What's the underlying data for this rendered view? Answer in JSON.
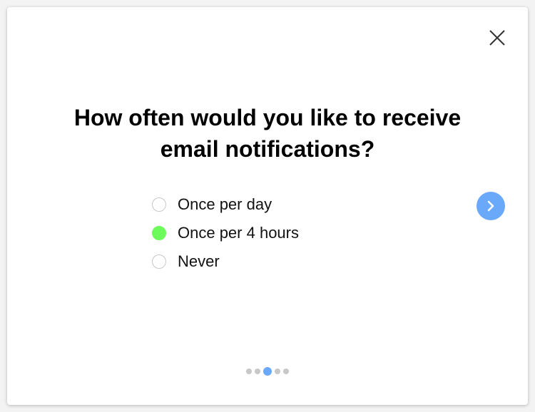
{
  "dialog": {
    "title_line1": "How often would you like to receive",
    "title_line2": "email notifications?",
    "options": [
      {
        "label": "Once per day",
        "selected": false
      },
      {
        "label": "Once per 4 hours",
        "selected": true
      },
      {
        "label": "Never",
        "selected": false
      }
    ],
    "pagination": {
      "total": 5,
      "current": 3
    },
    "colors": {
      "accent": "#6aa8fa",
      "selected": "#6dfb5c"
    }
  }
}
